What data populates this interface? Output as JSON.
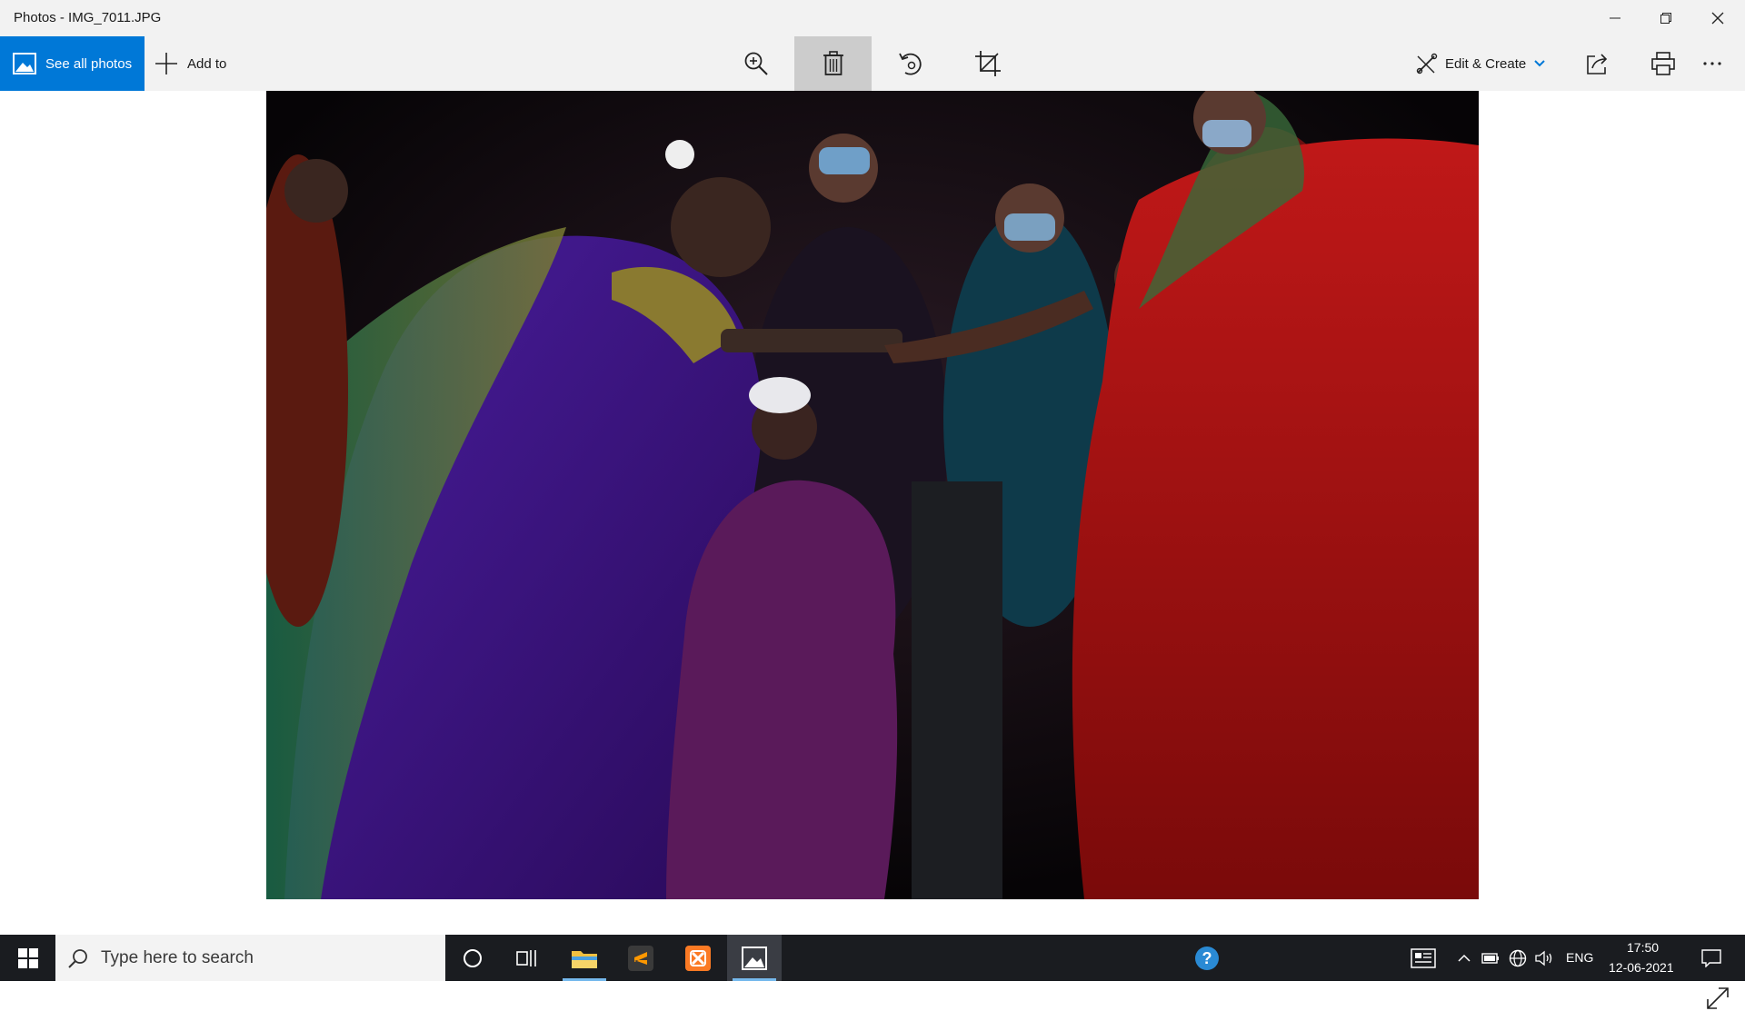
{
  "window": {
    "title": "Photos - IMG_7011.JPG"
  },
  "toolbar": {
    "see_all_label": "See all photos",
    "add_to_label": "Add to",
    "edit_create_label": "Edit & Create"
  },
  "taskbar": {
    "search_placeholder": "Type here to search",
    "language": "ENG",
    "time": "17:50",
    "date": "12-06-2021"
  },
  "colors": {
    "accent": "#0078d7",
    "taskbar_bg": "#1a1c20",
    "chrome_bg": "#f2f2f2"
  }
}
